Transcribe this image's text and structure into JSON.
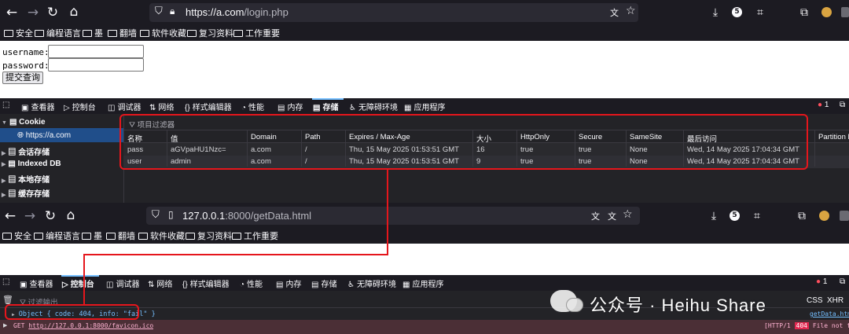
{
  "browser1": {
    "url_host": "https://a.com",
    "url_path": "/login.php",
    "download_badge": "5",
    "bookmarks": [
      "安全",
      "编程语言",
      "墨",
      "翻墙",
      "软件收藏",
      "复习资料",
      "工作重要"
    ]
  },
  "login": {
    "username_label": "username:",
    "password_label": "password:",
    "submit_label": "提交查询"
  },
  "devtools1": {
    "tabs": [
      "查看器",
      "控制台",
      "调试器",
      "网络",
      "样式编辑器",
      "性能",
      "内存",
      "存储",
      "无障碍环境",
      "应用程序"
    ],
    "active_tab": "存储",
    "error_count": "1",
    "filter_placeholder": "项目过滤器",
    "tree": {
      "cookie": "Cookie",
      "cookie_host": "https://a.com",
      "session": "会话存储",
      "indexeddb": "Indexed DB",
      "local": "本地存储",
      "cache": "缓存存储"
    },
    "columns": [
      "名称",
      "值",
      "Domain",
      "Path",
      "Expires / Max-Age",
      "大小",
      "HttpOnly",
      "Secure",
      "SameSite",
      "最后访问",
      "Partition K"
    ],
    "rows": [
      [
        "pass",
        "aGVpaHU1Nzc=",
        "a.com",
        "/",
        "Thu, 15 May 2025 01:53:51 GMT",
        "16",
        "true",
        "true",
        "None",
        "Wed, 14 May 2025 17:04:34 GMT",
        ""
      ],
      [
        "user",
        "admin",
        "a.com",
        "/",
        "Thu, 15 May 2025 01:53:51 GMT",
        "9",
        "true",
        "true",
        "None",
        "Wed, 14 May 2025 17:04:34 GMT",
        ""
      ]
    ]
  },
  "browser2": {
    "url_host": "127.0.0.1",
    "url_path": ":8000/getData.html",
    "download_badge": "5",
    "bookmarks": [
      "安全",
      "编程语言",
      "墨",
      "翻墙",
      "软件收藏",
      "复习资料",
      "工作重要"
    ]
  },
  "devtools2": {
    "tabs": [
      "查看器",
      "控制台",
      "调试器",
      "网络",
      "样式编辑器",
      "性能",
      "内存",
      "存储",
      "无障碍环境",
      "应用程序"
    ],
    "active_tab": "控制台",
    "error_count": "1",
    "filter_placeholder": "过滤输出",
    "right_filters": [
      "CSS",
      "XHR"
    ],
    "log_line": "Object { code: 404, info: \"fail\" }",
    "log_source": "getData.htm",
    "error_method": "GET",
    "error_url": "http://127.0.0.1:8000/favicon.ico",
    "error_protocol": "[HTTP/1",
    "error_status": "404",
    "error_text": "File not fou"
  },
  "watermark": {
    "text": "公众号 · Heihu Share"
  },
  "colors": {
    "annotation_red": "#e5161c",
    "selected_blue": "#204e8a",
    "toolbar_bg": "#1c1b22"
  }
}
